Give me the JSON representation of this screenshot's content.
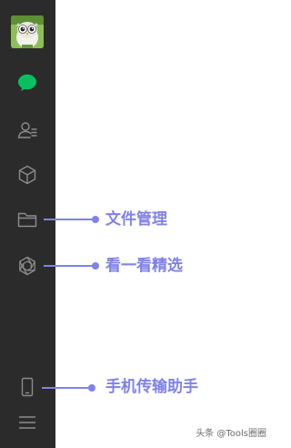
{
  "sidebar": {
    "avatar": {
      "icon": "owl-avatar-icon"
    },
    "items": [
      {
        "id": "chat",
        "icon": "chat-bubble-icon",
        "active": true,
        "color": "#07c160"
      },
      {
        "id": "contacts",
        "icon": "contacts-icon",
        "active": false,
        "color": "#8c8c8c"
      },
      {
        "id": "mini-programs",
        "icon": "cube-icon",
        "active": false,
        "color": "#8c8c8c"
      },
      {
        "id": "file-manager",
        "icon": "folder-icon",
        "active": false,
        "color": "#8c8c8c"
      },
      {
        "id": "top-stories",
        "icon": "aperture-icon",
        "active": false,
        "color": "#8c8c8c"
      },
      {
        "id": "phone-transfer",
        "icon": "phone-icon",
        "active": false,
        "color": "#8c8c8c"
      },
      {
        "id": "menu",
        "icon": "hamburger-menu-icon",
        "active": false,
        "color": "#8c8c8c"
      }
    ]
  },
  "callouts": {
    "file_manager": "文件管理",
    "top_stories": "看一看精选",
    "phone_transfer": "手机传输助手",
    "accent_color": "#7f82e8"
  },
  "watermark": "头条 @Tools圈圈"
}
